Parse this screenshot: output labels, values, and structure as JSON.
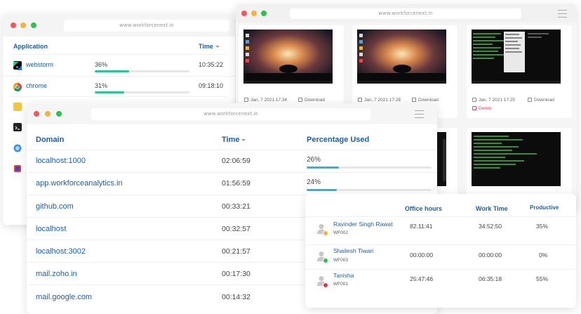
{
  "colors": {
    "red_dot": "#f4555f",
    "yellow_dot": "#f6b23c",
    "green_dot": "#2bc253",
    "accent_blue": "#1d5fa5",
    "bar_green": "#2ec3a0",
    "bar_cyan": "#2bb7d8",
    "bar_track": "#e6e6e6"
  },
  "apps_window": {
    "url": "www.workforcenext.in",
    "headers": {
      "application": "Application",
      "time": "Time"
    },
    "rows": [
      {
        "icon": "webstorm-icon",
        "name": "webstorm",
        "percent_label": "36%",
        "percent": 36,
        "time": "10:35:22"
      },
      {
        "icon": "chrome-icon",
        "name": "chrome",
        "percent_label": "31%",
        "percent": 31,
        "time": "09:18:10"
      },
      {
        "icon": "folder-icon"
      },
      {
        "icon": "terminal-icon"
      },
      {
        "icon": "browser-icon"
      },
      {
        "icon": "app-icon"
      }
    ]
  },
  "screens_window": {
    "url": "www.workforcenext.in",
    "cards": [
      {
        "thumb": "desktop-tree",
        "date": "Jan, 7 2021 17:34",
        "action": "Download"
      },
      {
        "thumb": "desktop-tree",
        "date": "Jan, 7 2021 17:28",
        "action": "Download"
      },
      {
        "thumb": "terminal",
        "date": "Jan, 7 2021 17:25",
        "action": "Download",
        "delete": "Delete"
      },
      {
        "thumb": "desktop-tree"
      },
      {
        "thumb": "desktop-tree"
      },
      {
        "thumb": "terminal"
      }
    ]
  },
  "domains_window": {
    "url": "www.workforcenext.in",
    "headers": {
      "domain": "Domain",
      "time": "Time",
      "percentage": "Percentage Used"
    },
    "rows": [
      {
        "domain": "localhost:1000",
        "time": "02:06:59",
        "percent_label": "26%",
        "percent": 26
      },
      {
        "domain": "app.workforceanalytics.in",
        "time": "01:56:59",
        "percent_label": "24%",
        "percent": 24
      },
      {
        "domain": "github.com",
        "time": "00:33:21"
      },
      {
        "domain": "localhost",
        "time": "00:32:57"
      },
      {
        "domain": "localhost:3002",
        "time": "00:21:57"
      },
      {
        "domain": "mail.zoho.in",
        "time": "00:17:30"
      },
      {
        "domain": "mail.google.com",
        "time": "00:14:32"
      }
    ]
  },
  "employees_window": {
    "headers": {
      "office_hours": "Office hours",
      "work_time": "Work Time",
      "productive": "Productive"
    },
    "rows": [
      {
        "name": "Ravinder Singh Rawat",
        "id": "WF002",
        "status": "away",
        "status_color": "#f6b23c",
        "office_hours": "82:11:41",
        "work_time": "34:52:50",
        "productive": "35%"
      },
      {
        "name": "Shailesh Tiwari",
        "id": "WF003",
        "status": "online",
        "status_color": "#2bc253",
        "office_hours": "00:00:00",
        "work_time": "00:00:00",
        "productive": "0%"
      },
      {
        "name": "Tanisha",
        "id": "WF001",
        "status": "offline",
        "status_color": "#e0393e",
        "office_hours": "25:47:46",
        "work_time": "06:35:18",
        "productive": "55%"
      }
    ]
  }
}
